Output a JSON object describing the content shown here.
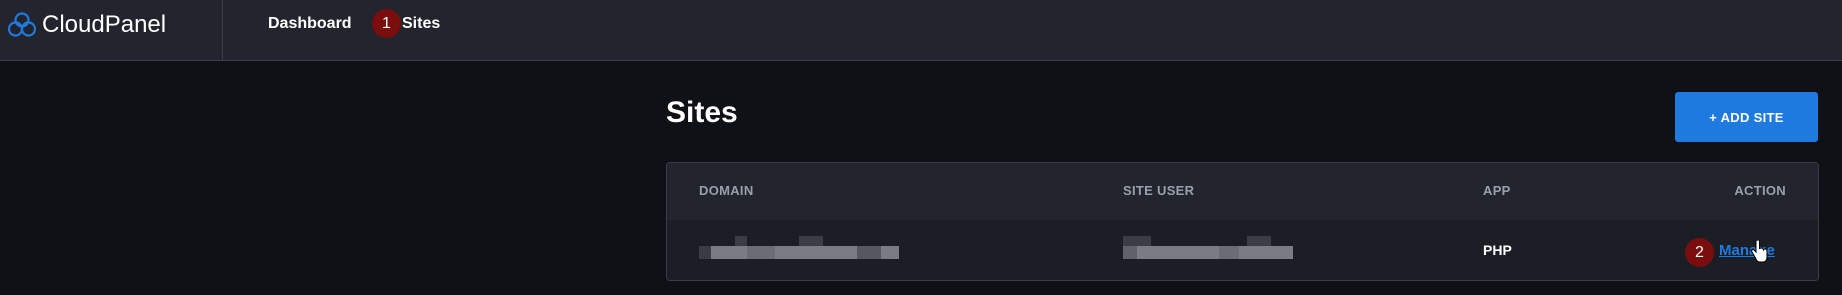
{
  "app": {
    "name": "CloudPanel",
    "brand_color": "#1f7ae0",
    "logo_icon": "cloud-logo-icon"
  },
  "nav": {
    "items": [
      {
        "label": "Dashboard"
      },
      {
        "label": "Sites"
      }
    ]
  },
  "steps": [
    "1",
    "2"
  ],
  "page": {
    "title": "Sites",
    "add_button_label": "+ ADD SITE"
  },
  "table": {
    "columns": [
      "DOMAIN",
      "SITE USER",
      "APP",
      "ACTION"
    ],
    "rows": [
      {
        "domain": "",
        "site_user": "",
        "app": "PHP",
        "action": "Manage"
      }
    ]
  },
  "colors": {
    "accent": "#1f7ae0",
    "badge": "#7a0d0d",
    "background": "#0f1116",
    "topbar": "#22252d"
  }
}
